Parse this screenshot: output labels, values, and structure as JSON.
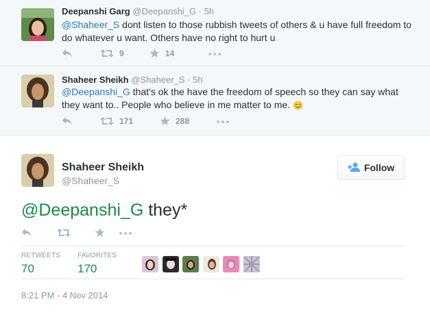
{
  "tweets": [
    {
      "name": "Deepanshi Garg",
      "handle": "@Deepanshi_G",
      "time": "5h",
      "mention": "@Shaheer_S",
      "text": " dont listen to those rubbish tweets of others & u have full freedom to do whatever u want. Others have no right to hurt u",
      "retweets": "9",
      "favorites": "14"
    },
    {
      "name": "Shaheer Sheikh",
      "handle": "@Shaheer_S",
      "time": "5h",
      "mention": "@Deepanshi_G",
      "text": " that's ok the have the freedom of speech so they can say what they want to.. People who believe in me matter to me. ",
      "emoji": "😊",
      "retweets": "171",
      "favorites": "288"
    }
  ],
  "main": {
    "name": "Shaheer Sheikh",
    "handle": "@Shaheer_S",
    "follow_label": "Follow",
    "mention": "@Deepanshi_G",
    "text": " they*",
    "retweets_label": "RETWEETS",
    "retweets": "70",
    "favorites_label": "FAVORITES",
    "favorites": "170",
    "timestamp": "8:21 PM - 4 Nov 2014"
  },
  "colors": {
    "link": "#2b7bb9",
    "mention_green": "#1b8a48",
    "muted": "#8899a6"
  },
  "icons": [
    "reply-icon",
    "retweet-icon",
    "favorite-icon",
    "more-icon",
    "follow-user-icon"
  ]
}
